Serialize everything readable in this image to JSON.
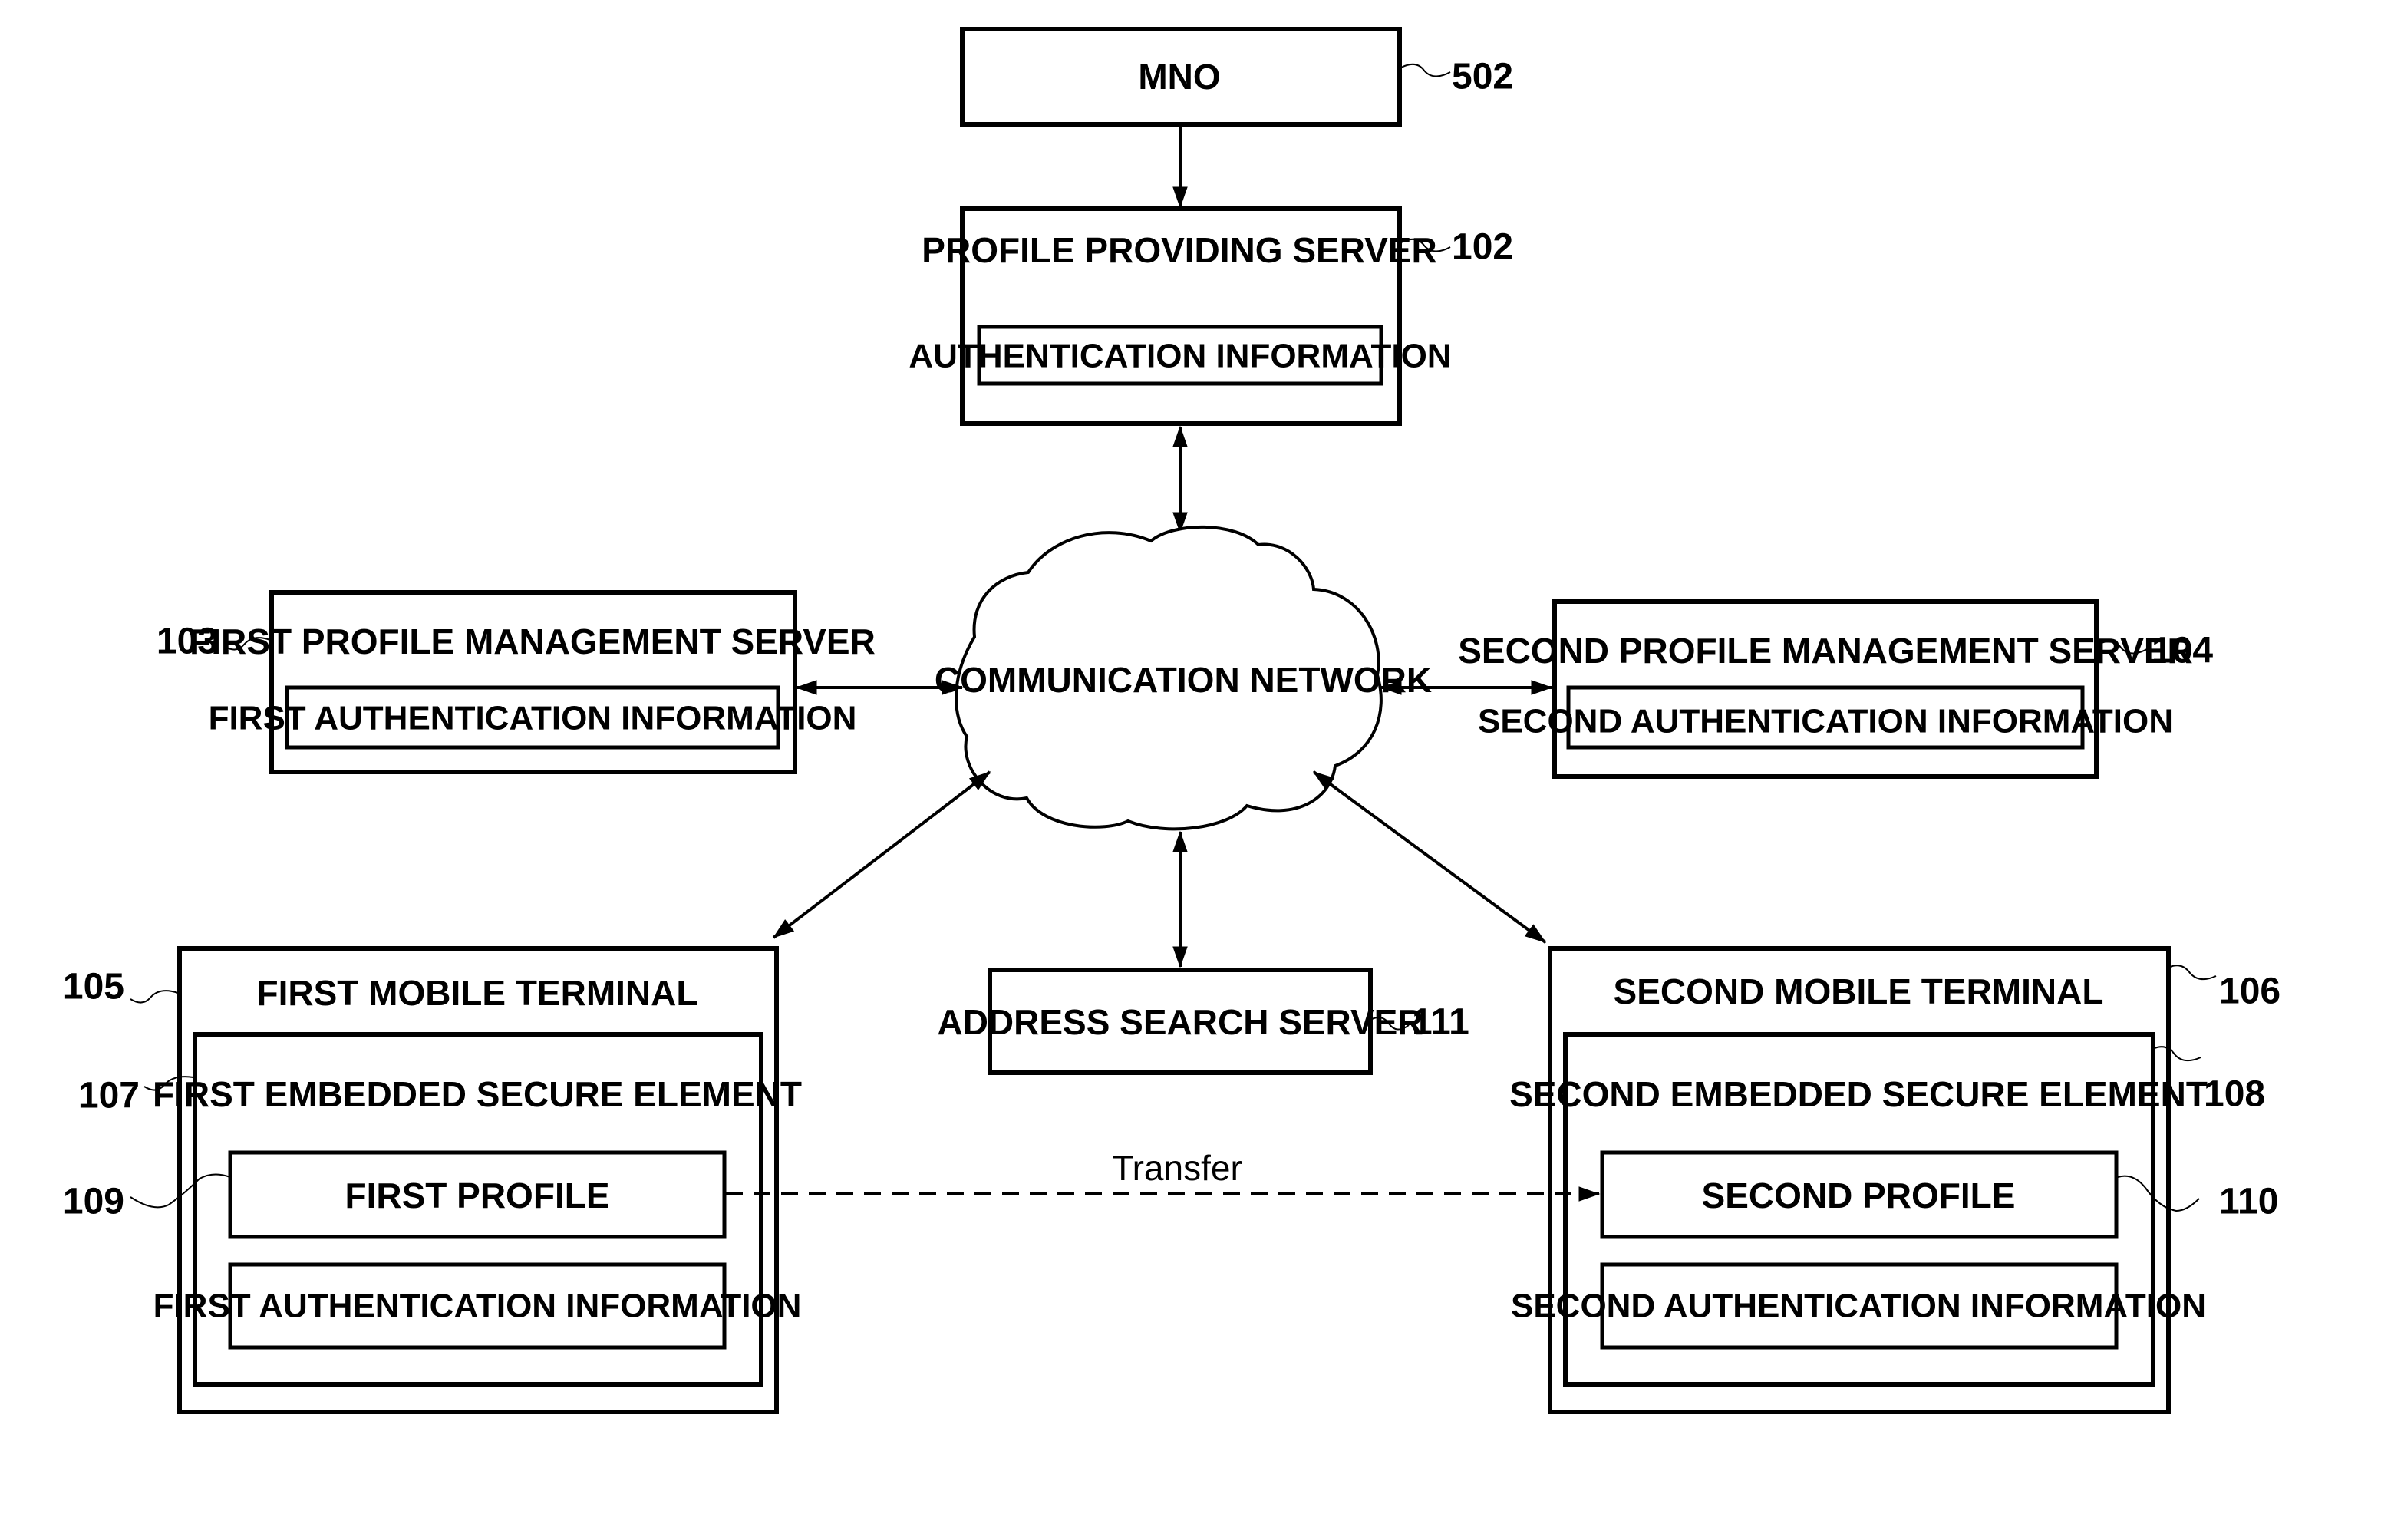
{
  "diagram": {
    "colors": {
      "stroke": "#000000",
      "background": "#ffffff"
    },
    "nodes": {
      "mno": {
        "label": "MNO",
        "ref": "502"
      },
      "profile_providing_server": {
        "label": "PROFILE PROVIDING SERVER",
        "ref": "102",
        "sub": "AUTHENTICATION INFORMATION"
      },
      "first_profile_management_server": {
        "label": "FIRST PROFILE MANAGEMENT SERVER",
        "ref": "103",
        "sub": "FIRST AUTHENTICATION INFORMATION"
      },
      "second_profile_management_server": {
        "label": "SECOND PROFILE MANAGEMENT SERVER",
        "ref": "104",
        "sub": "SECOND AUTHENTICATION INFORMATION"
      },
      "communication_network": {
        "label": "COMMUNICATION NETWORK"
      },
      "address_search_server": {
        "label": "ADDRESS SEARCH SERVER",
        "ref": "111"
      },
      "first_mobile_terminal": {
        "label": "FIRST MOBILE TERMINAL",
        "ref": "105",
        "esim": {
          "label": "FIRST EMBEDDED SECURE ELEMENT",
          "ref": "107",
          "profile": {
            "label": "FIRST PROFILE",
            "ref": "109"
          },
          "auth": {
            "label": "FIRST AUTHENTICATION INFORMATION"
          }
        }
      },
      "second_mobile_terminal": {
        "label": "SECOND MOBILE TERMINAL",
        "ref": "106",
        "esim": {
          "label": "SECOND EMBEDDED SECURE ELEMENT",
          "ref": "108",
          "profile": {
            "label": "SECOND PROFILE",
            "ref": "110"
          },
          "auth": {
            "label": "SECOND AUTHENTICATION INFORMATION"
          }
        }
      }
    },
    "edges": [
      {
        "from": "mno",
        "to": "profile_providing_server",
        "direction": "one-way"
      },
      {
        "from": "profile_providing_server",
        "to": "communication_network",
        "direction": "two-way"
      },
      {
        "from": "first_profile_management_server",
        "to": "communication_network",
        "direction": "two-way"
      },
      {
        "from": "second_profile_management_server",
        "to": "communication_network",
        "direction": "two-way"
      },
      {
        "from": "communication_network",
        "to": "address_search_server",
        "direction": "two-way"
      },
      {
        "from": "communication_network",
        "to": "first_mobile_terminal",
        "direction": "two-way"
      },
      {
        "from": "communication_network",
        "to": "second_mobile_terminal",
        "direction": "two-way"
      },
      {
        "from": "first_profile",
        "to": "second_profile",
        "direction": "one-way",
        "style": "dashed",
        "label": "Transfer"
      }
    ]
  }
}
